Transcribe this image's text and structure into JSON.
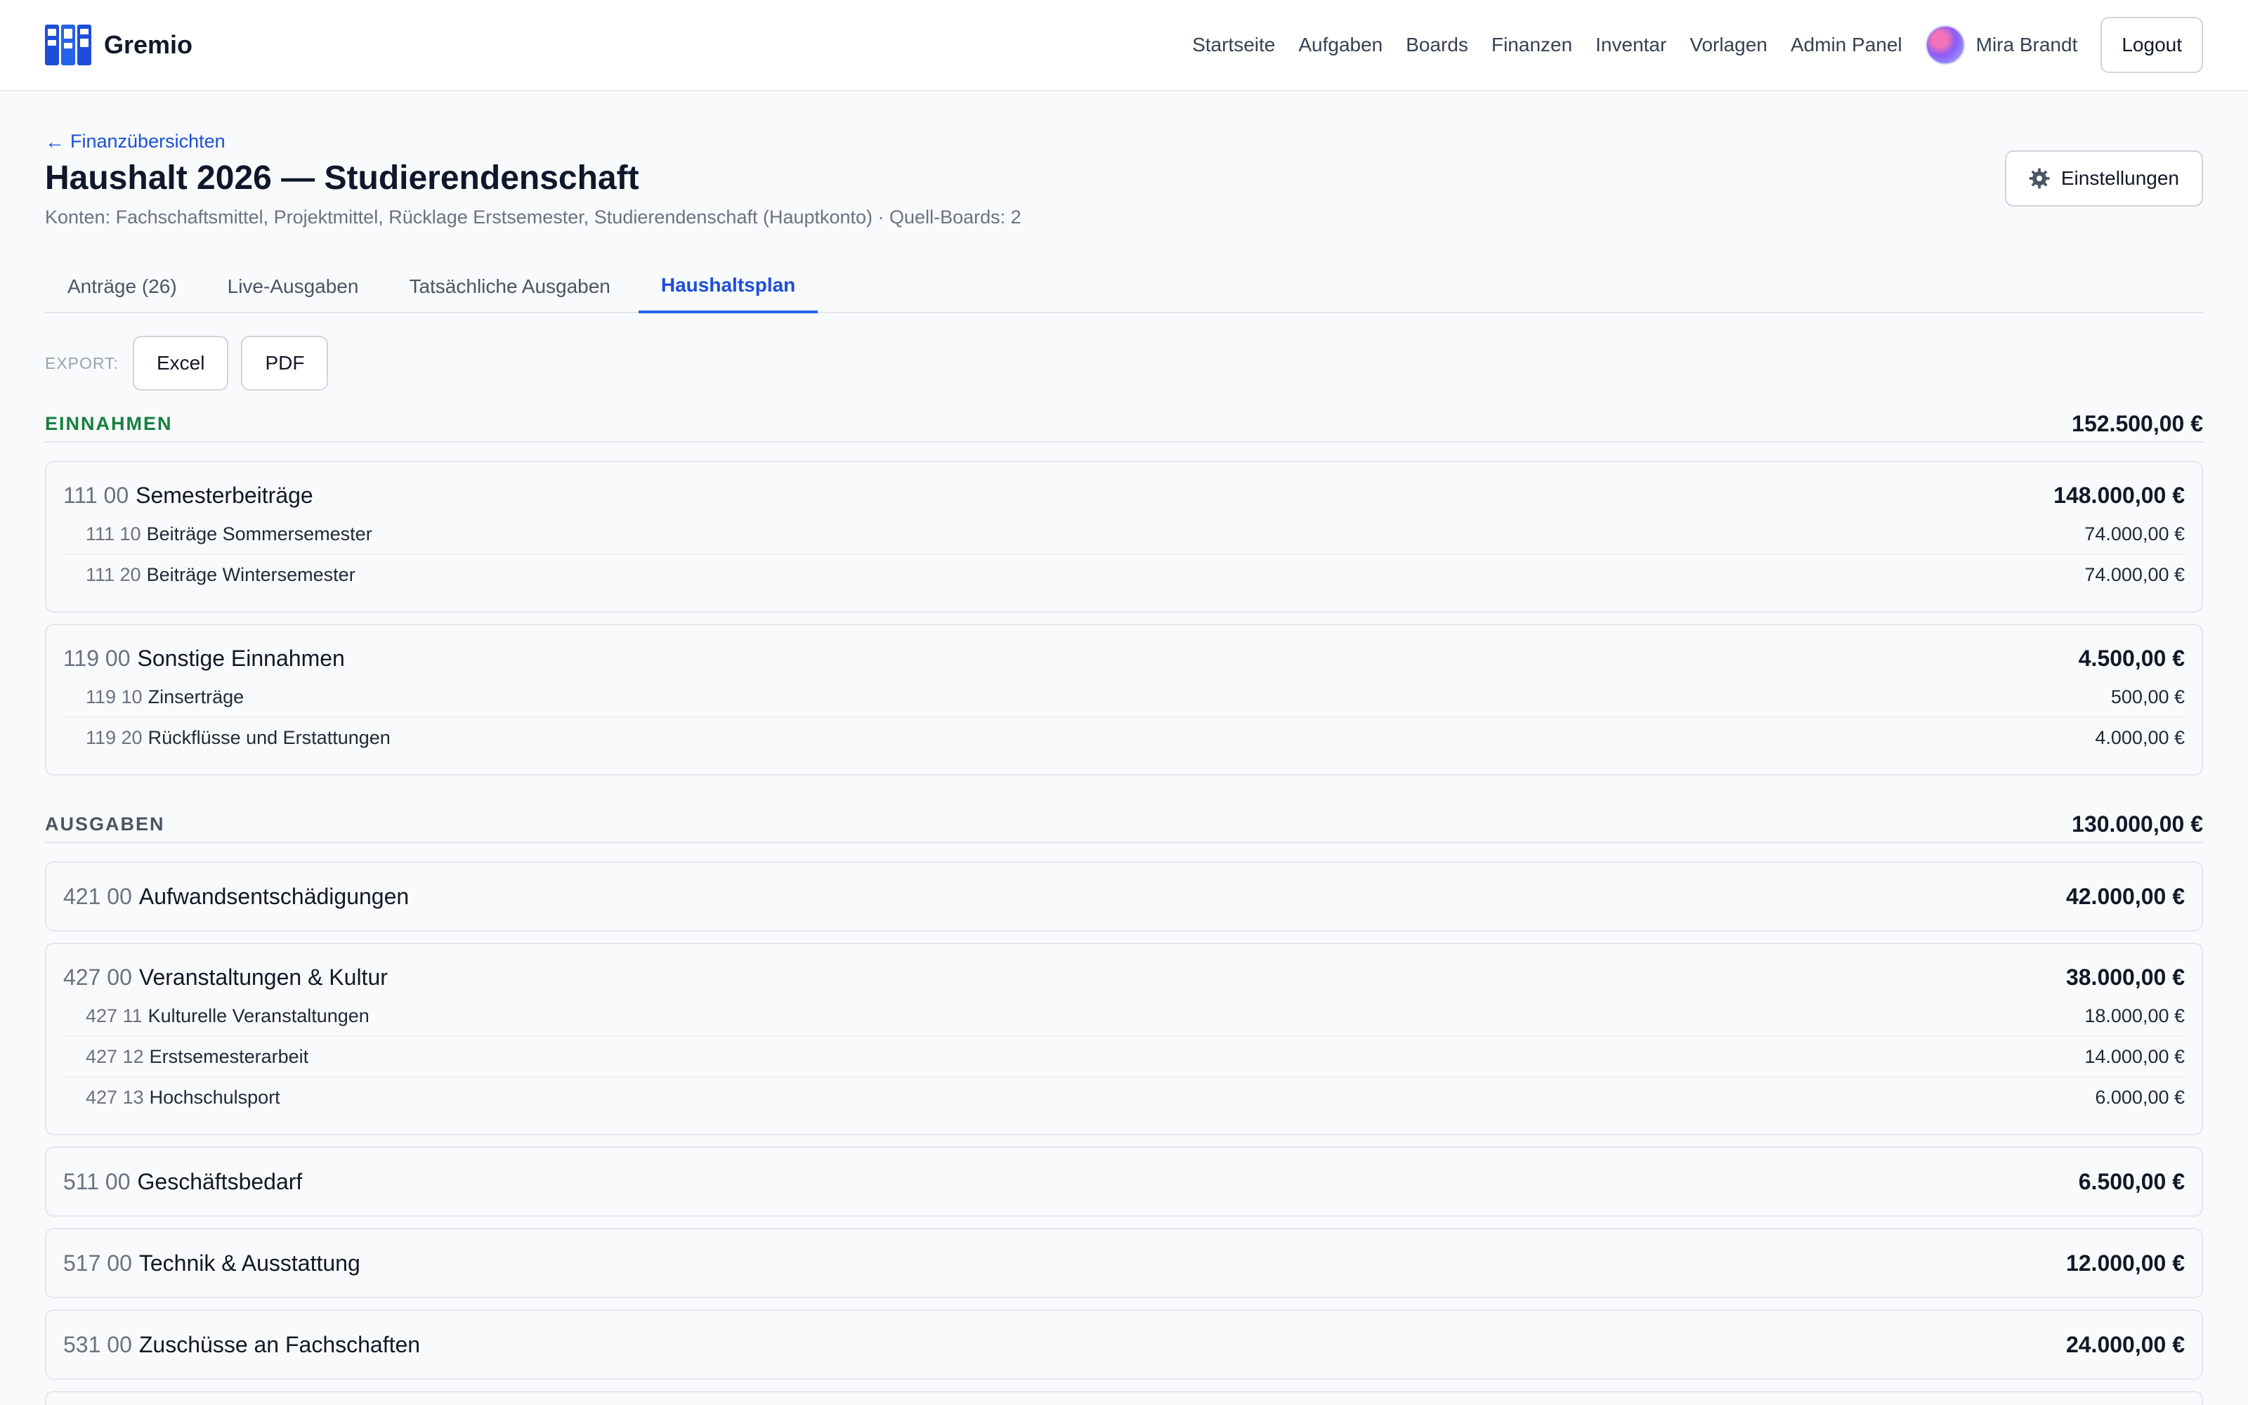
{
  "header": {
    "brand": "Gremio",
    "nav": [
      "Startseite",
      "Aufgaben",
      "Boards",
      "Finanzen",
      "Inventar",
      "Vorlagen",
      "Admin Panel"
    ],
    "user_name": "Mira Brandt",
    "logout_label": "Logout"
  },
  "page": {
    "back_label": "Finanzübersichten",
    "title": "Haushalt 2026 — Studierendenschaft",
    "subtitle": "Konten: Fachschaftsmittel, Projektmittel, Rücklage Erstsemester, Studierendenschaft (Hauptkonto) · Quell-Boards: 2",
    "settings_label": "Einstellungen"
  },
  "tabs": [
    {
      "label": "Anträge (26)",
      "active": false
    },
    {
      "label": "Live-Ausgaben",
      "active": false
    },
    {
      "label": "Tatsächliche Ausgaben",
      "active": false
    },
    {
      "label": "Haushaltsplan",
      "active": true
    }
  ],
  "export": {
    "label": "EXPORT:",
    "excel_label": "Excel",
    "pdf_label": "PDF"
  },
  "income": {
    "title": "EINNAHMEN",
    "total": "152.500,00 €",
    "groups": [
      {
        "code": "111 00",
        "name": "Semesterbeiträge",
        "amount": "148.000,00 €",
        "items": [
          {
            "code": "111 10",
            "name": "Beiträge Sommersemester",
            "amount": "74.000,00 €"
          },
          {
            "code": "111 20",
            "name": "Beiträge Wintersemester",
            "amount": "74.000,00 €"
          }
        ]
      },
      {
        "code": "119 00",
        "name": "Sonstige Einnahmen",
        "amount": "4.500,00 €",
        "items": [
          {
            "code": "119 10",
            "name": "Zinserträge",
            "amount": "500,00 €"
          },
          {
            "code": "119 20",
            "name": "Rückflüsse und Erstattungen",
            "amount": "4.000,00 €"
          }
        ]
      }
    ]
  },
  "expenses": {
    "title": "AUSGABEN",
    "total": "130.000,00 €",
    "groups": [
      {
        "code": "421 00",
        "name": "Aufwandsentschädigungen",
        "amount": "42.000,00 €",
        "items": []
      },
      {
        "code": "427 00",
        "name": "Veranstaltungen & Kultur",
        "amount": "38.000,00 €",
        "items": [
          {
            "code": "427 11",
            "name": "Kulturelle Veranstaltungen",
            "amount": "18.000,00 €"
          },
          {
            "code": "427 12",
            "name": "Erstsemesterarbeit",
            "amount": "14.000,00 €"
          },
          {
            "code": "427 13",
            "name": "Hochschulsport",
            "amount": "6.000,00 €"
          }
        ]
      },
      {
        "code": "511 00",
        "name": "Geschäftsbedarf",
        "amount": "6.500,00 €",
        "items": []
      },
      {
        "code": "517 00",
        "name": "Technik & Ausstattung",
        "amount": "12.000,00 €",
        "items": []
      },
      {
        "code": "531 00",
        "name": "Zuschüsse an Fachschaften",
        "amount": "24.000,00 €",
        "items": []
      }
    ]
  }
}
